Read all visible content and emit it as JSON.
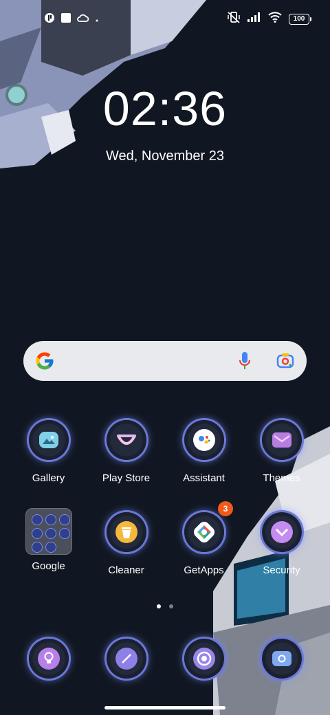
{
  "status_bar": {
    "battery": "100"
  },
  "lock": {
    "time": "02:36",
    "date": "Wed, November 23"
  },
  "search": {
    "provider": "google-icon"
  },
  "apps_row1": [
    {
      "label": "Gallery"
    },
    {
      "label": "Play Store"
    },
    {
      "label": "Assistant"
    },
    {
      "label": "Themes"
    }
  ],
  "apps_row2": [
    {
      "label": "Google"
    },
    {
      "label": "Cleaner"
    },
    {
      "label": "GetApps",
      "badge": "3"
    },
    {
      "label": "Security"
    }
  ],
  "page_indicator": {
    "pages": 2,
    "active": 1
  },
  "colors": {
    "accent_ring": "#6b78d8",
    "badge": "#f25a1a",
    "background": "#111722"
  }
}
